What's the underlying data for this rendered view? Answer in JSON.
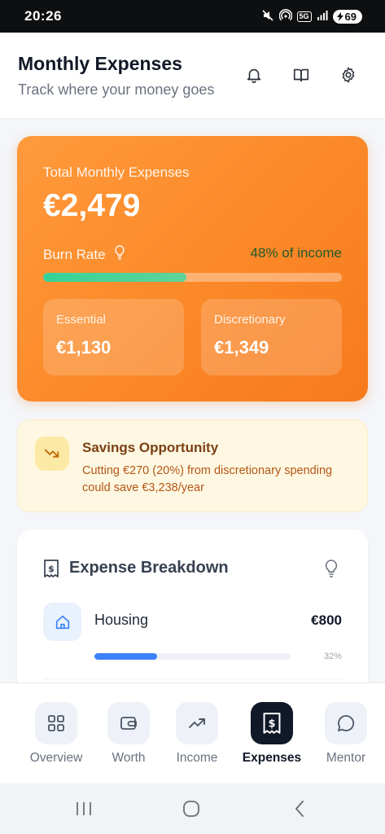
{
  "status_bar": {
    "time": "20:26",
    "network": "5G",
    "battery": "69"
  },
  "header": {
    "title": "Monthly Expenses",
    "subtitle": "Track where your money goes"
  },
  "summary": {
    "label": "Total Monthly Expenses",
    "total": "€2,479",
    "burn_rate_label": "Burn Rate",
    "burn_rate_value": "48% of income",
    "burn_rate_fraction": 0.48,
    "essential_label": "Essential",
    "essential_value": "€1,130",
    "discretionary_label": "Discretionary",
    "discretionary_value": "€1,349"
  },
  "savings": {
    "title": "Savings Opportunity",
    "text": "Cutting €270 (20%) from discretionary spending could save €3,238/year"
  },
  "breakdown": {
    "title": "Expense Breakdown",
    "items": [
      {
        "name": "Housing",
        "amount": "€800",
        "percent_label": "32%",
        "fraction": 0.32,
        "icon": "house-icon"
      }
    ]
  },
  "nav": {
    "items": [
      {
        "label": "Overview",
        "icon": "grid-icon",
        "active": false
      },
      {
        "label": "Worth",
        "icon": "wallet-icon",
        "active": false
      },
      {
        "label": "Income",
        "icon": "trending-up-icon",
        "active": false
      },
      {
        "label": "Expenses",
        "icon": "receipt-icon",
        "active": true
      },
      {
        "label": "Mentor",
        "icon": "chat-icon",
        "active": false
      }
    ]
  },
  "colors": {
    "accent_orange": "#fb8a2a",
    "burn_green": "#34d399",
    "housing_blue": "#3b82f6",
    "nav_active": "#111827"
  }
}
